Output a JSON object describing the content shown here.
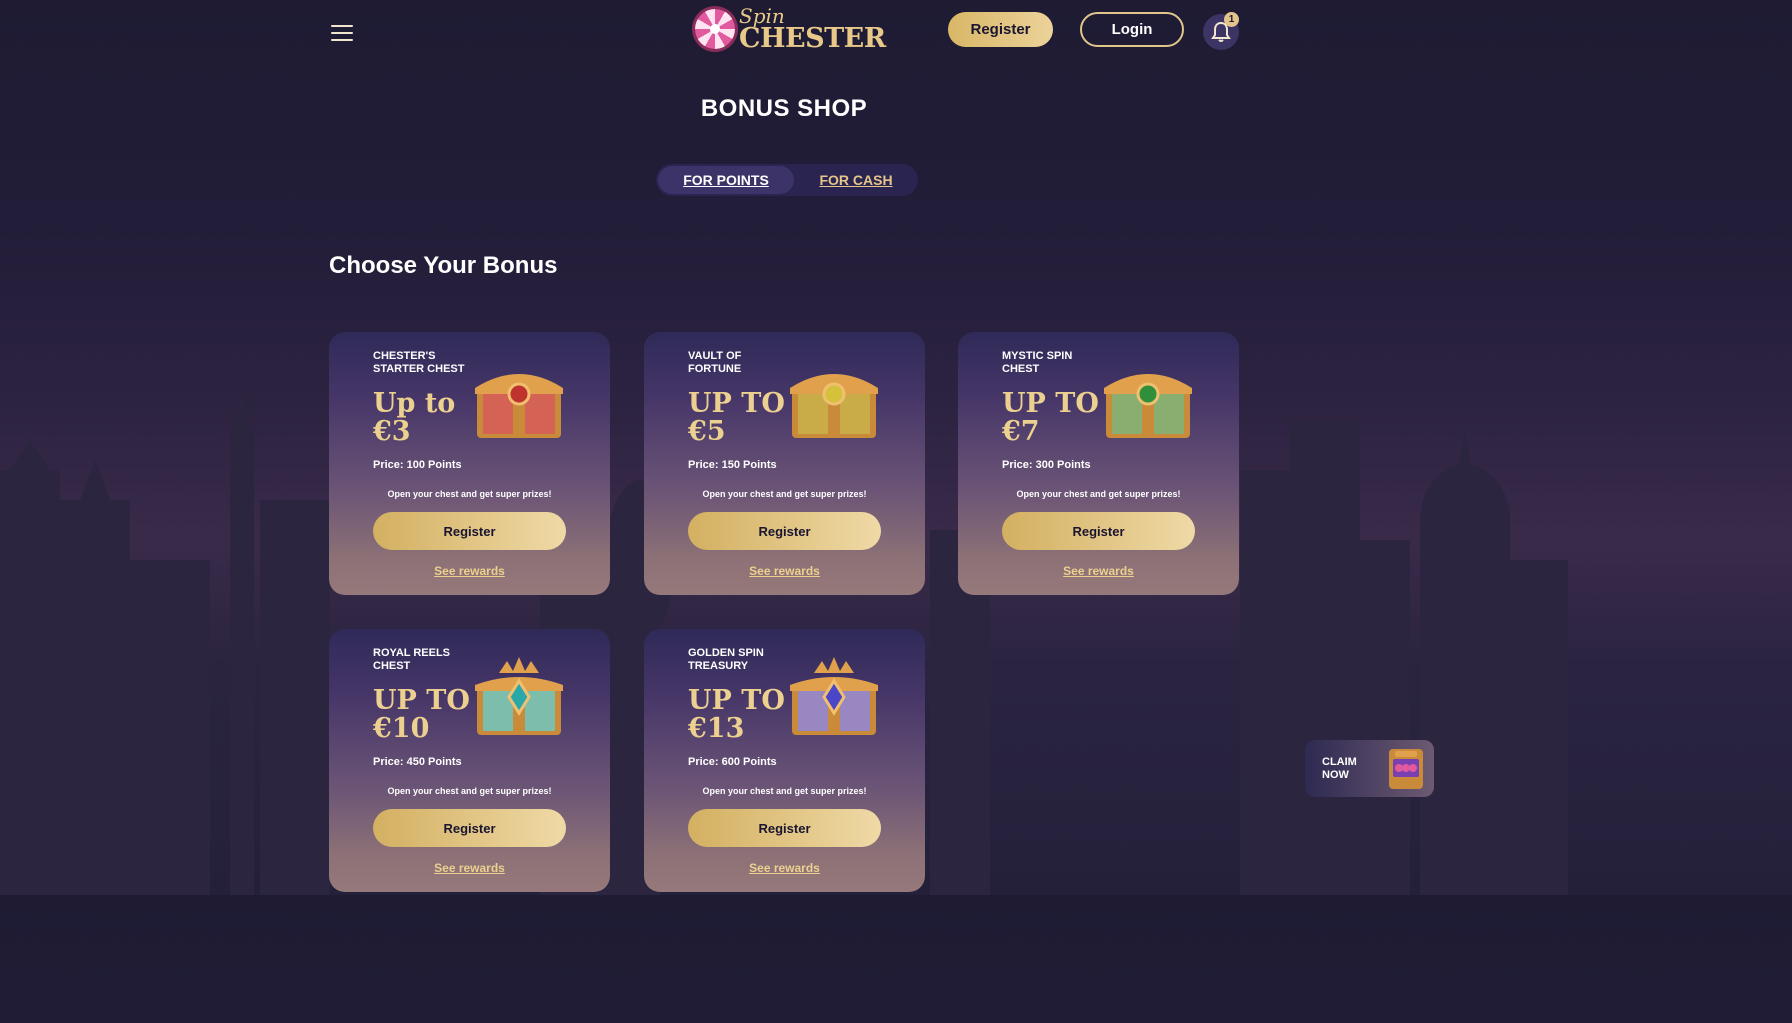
{
  "header": {
    "logo_top": "Spin",
    "logo_bottom": "CHESTER",
    "register_label": "Register",
    "login_label": "Login",
    "notification_count": "1"
  },
  "page_title": "BONUS SHOP",
  "tabs": [
    {
      "label": "FOR POINTS",
      "active": true
    },
    {
      "label": "FOR CASH",
      "active": false
    }
  ],
  "section_title": "Choose Your Bonus",
  "cards": [
    {
      "name": "CHESTER'S STARTER CHEST",
      "amount": "Up to €3",
      "price": "Price: 100 Points",
      "description": "Open your chest and get super prizes!",
      "button": "Register",
      "link": "See rewards",
      "chest_color": "#d65a5a",
      "gem_color": "#c0322e"
    },
    {
      "name": "VAULT OF FORTUNE",
      "amount": "UP TO €5",
      "price": "Price: 150 Points",
      "description": "Open your chest and get super prizes!",
      "button": "Register",
      "link": "See rewards",
      "chest_color": "#c9b24a",
      "gem_color": "#d4c23a"
    },
    {
      "name": "MYSTIC SPIN CHEST",
      "amount": "UP TO €7",
      "price": "Price: 300 Points",
      "description": "Open your chest and get super prizes!",
      "button": "Register",
      "link": "See rewards",
      "chest_color": "#7fb37a",
      "gem_color": "#2f8f3a"
    },
    {
      "name": "ROYAL REELS CHEST",
      "amount": "UP TO €10",
      "price": "Price: 450 Points",
      "description": "Open your chest and get super prizes!",
      "button": "Register",
      "link": "See rewards",
      "chest_color": "#6ec5c0",
      "gem_color": "#2aa7a8"
    },
    {
      "name": "GOLDEN SPIN TREASURY",
      "amount": "UP TO €13",
      "price": "Price: 600 Points",
      "description": "Open your chest and get super prizes!",
      "button": "Register",
      "link": "See rewards",
      "chest_color": "#8f86d8",
      "gem_color": "#4b45c8"
    }
  ],
  "claim": {
    "label": "CLAIM NOW"
  },
  "colors": {
    "accent_gold": "#e2c58a",
    "background": "#221d38"
  }
}
